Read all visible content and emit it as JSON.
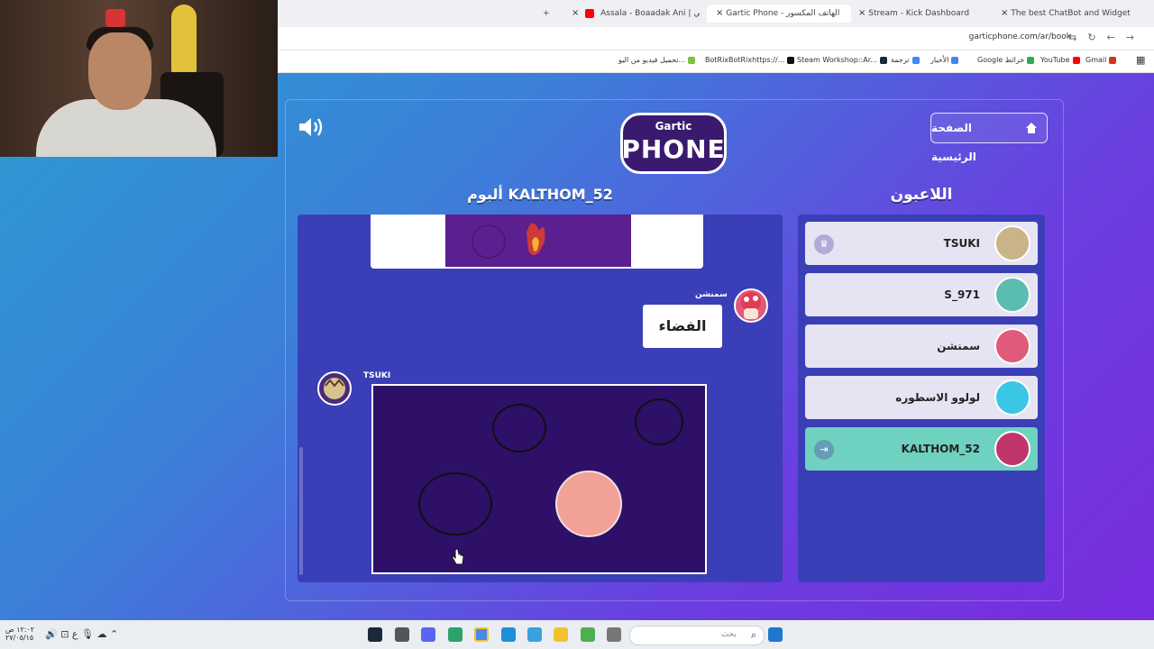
{
  "browser": {
    "tabs": [
      {
        "label": "The best ChatBot and Widgets"
      },
      {
        "label": "Stream - Kick Dashboard"
      },
      {
        "label": "Gartic Phone - الهاتف المكسور"
      },
      {
        "label": "Assala - Boaadak Ani | عني"
      }
    ],
    "new_tab": "+",
    "url": "garticphone.com/ar/book",
    "bookmarks": [
      {
        "label": "Gmail",
        "color": "#d93025"
      },
      {
        "label": "YouTube",
        "color": "#ff0000"
      },
      {
        "label": "Google خرائط",
        "color": "#34a853"
      },
      {
        "label": "الأخبار",
        "color": "#4285f4"
      },
      {
        "label": "ترجمة",
        "color": "#4285f4"
      },
      {
        "label": "Steam Workshop::Ar...",
        "color": "#1b2838"
      },
      {
        "label": "BotRixBotRixhttps://...",
        "color": "#111111"
      },
      {
        "label": "تحميل فيديو من اليو...",
        "color": "#7bc142"
      }
    ]
  },
  "game": {
    "logo_top": "Gartic",
    "logo_main": "PHONE",
    "home_button": "الصفحة الرئيسية",
    "album_title": "ألبوم KALTHOM_52",
    "players_title": "اللاعبون",
    "answer_author": "سمنشن",
    "answer_text": "الفضاء",
    "drawing_author": "TSUKI",
    "players": [
      {
        "name": "TSUKI",
        "badge": "♛",
        "color": "#c9b48a"
      },
      {
        "name": "S_971",
        "badge": "",
        "color": "#5bbdb0"
      },
      {
        "name": "سمنشن",
        "badge": "",
        "color": "#e05a7a"
      },
      {
        "name": "لولوو الاسطوره",
        "badge": "",
        "color": "#3cc6e6"
      },
      {
        "name": "KALTHOM_52",
        "badge": "⇥",
        "color": "#c0356b"
      }
    ]
  },
  "taskbar": {
    "time": "١٢:٠٢ ص",
    "date": "٢٧/٠٥/١٥",
    "lang": "ع",
    "search_placeholder": "بحث"
  }
}
